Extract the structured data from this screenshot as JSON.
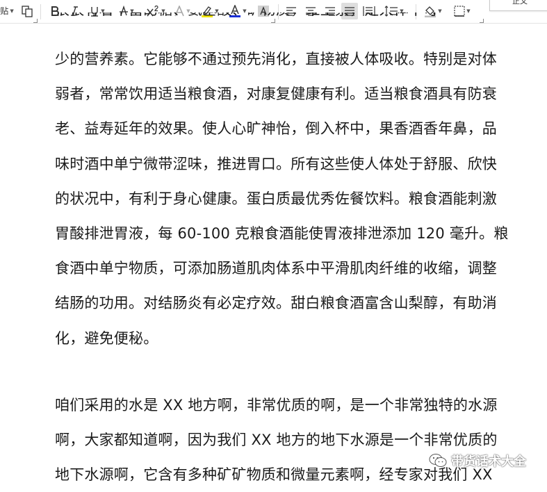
{
  "toolbar": {
    "paste_label": "贴",
    "style_label": "正文",
    "highlight_color": "#f2e600",
    "font_color": "#1a2fd6"
  },
  "document": {
    "paragraphs": [
      [
        "少的营养素。它能够不通过预先消化，直接被人体吸收。特别是对体",
        "弱者，常常饮用适当粮食酒，对康复健康有利。适当粮食酒具有防衰",
        "老、益寿延年的效果。使人心旷神怡，倒入杯中，果香酒香年鼻，品",
        "味时酒中单宁微带涩味，推进胃口。所有这些使人体处于舒服、欣快",
        "的状况中，有利于身心健康。蛋白质最优秀佐餐饮料。粮食酒能刺激",
        "胃酸排泄胃液，每 60-100 克粮食酒能使胃液排泄添加 120 毫升。粮",
        "食酒中单宁物质，可添加肠道肌肉体系中平滑肌肉纤维的收缩，调整",
        "结肠的功用。对结肠炎有必定疗效。甜白粮食酒富含山梨醇，有助消",
        "化，避免便秘。"
      ],
      [
        "咱们采用的水是 XX 地方啊，非常优质的啊，是一个非常独特的水源",
        "啊，大家都知道啊，因为我们 XX 地方的地下水源是一个非常优质的",
        "地下水源啊，它含有多种矿矿物质和微量元素啊，经专家对我们 XX"
      ]
    ]
  },
  "watermark": {
    "text": "带货话术大全",
    "icon": "wechat-icon"
  }
}
